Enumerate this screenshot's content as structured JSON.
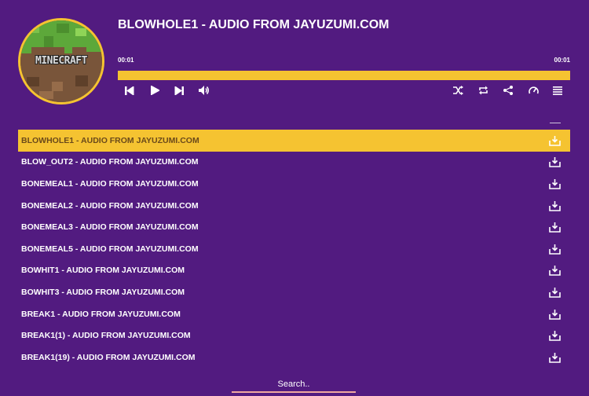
{
  "cover": {
    "logo_text": "MINECRAFT",
    "icon": "minecraft-grass-block-icon"
  },
  "player": {
    "title": "BLOWHOLE1 - AUDIO FROM JAYUZUMI.COM",
    "current_time": "00:01",
    "duration": "00:01",
    "progress": 1.0
  },
  "controls": {
    "left": [
      "skip-previous-icon",
      "play-icon",
      "skip-next-icon",
      "volume-icon"
    ],
    "right": [
      "shuffle-icon",
      "repeat-icon",
      "share-icon",
      "speed-icon",
      "playlist-icon"
    ]
  },
  "colors": {
    "background": "#521b80",
    "accent": "#f5c331",
    "active_text": "#6b4a1a"
  },
  "playlist": [
    {
      "label": "BLOWHOLE1 - AUDIO FROM JAYUZUMI.COM",
      "active": true
    },
    {
      "label": "BLOW_OUT2 - AUDIO FROM JAYUZUMI.COM",
      "active": false
    },
    {
      "label": "BONEMEAL1 - AUDIO FROM JAYUZUMI.COM",
      "active": false
    },
    {
      "label": "BONEMEAL2 - AUDIO FROM JAYUZUMI.COM",
      "active": false
    },
    {
      "label": "BONEMEAL3 - AUDIO FROM JAYUZUMI.COM",
      "active": false
    },
    {
      "label": "BONEMEAL5 - AUDIO FROM JAYUZUMI.COM",
      "active": false
    },
    {
      "label": "BOWHIT1 - AUDIO FROM JAYUZUMI.COM",
      "active": false
    },
    {
      "label": "BOWHIT3 - AUDIO FROM JAYUZUMI.COM",
      "active": false
    },
    {
      "label": "BREAK1 - AUDIO FROM JAYUZUMI.COM",
      "active": false
    },
    {
      "label": "BREAK1(1) - AUDIO FROM JAYUZUMI.COM",
      "active": false
    },
    {
      "label": "BREAK1(19) - AUDIO FROM JAYUZUMI.COM",
      "active": false
    }
  ],
  "search": {
    "placeholder": "Search.."
  }
}
